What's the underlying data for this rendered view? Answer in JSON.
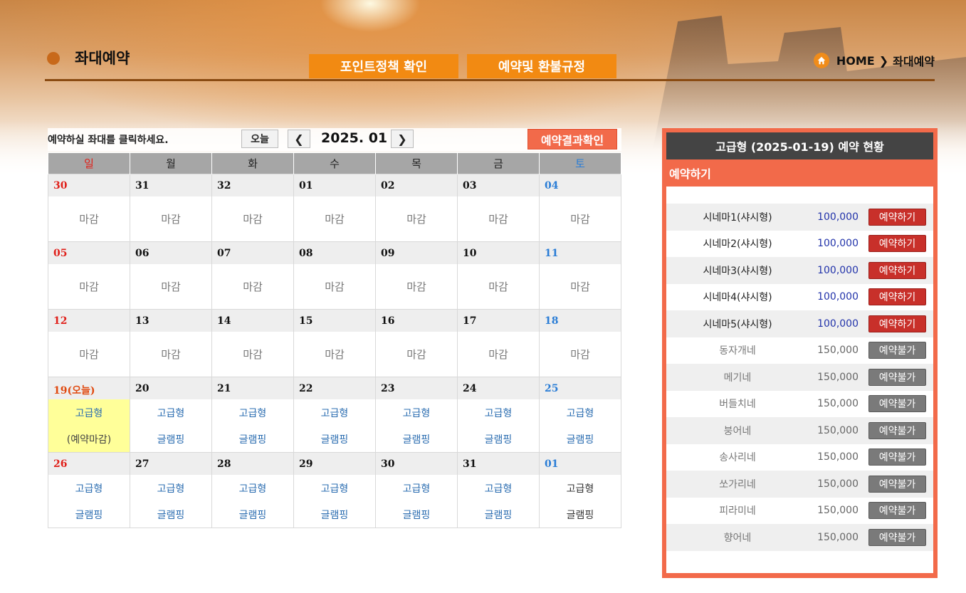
{
  "header": {
    "title": "좌대예약",
    "point_button": "포인트정책 확인",
    "refund_button": "예약및 환불규정",
    "breadcrumb_home": "HOME",
    "breadcrumb_sep": "❯",
    "breadcrumb_current": "좌대예약"
  },
  "toolbar": {
    "instruction": "예약하실 좌대를 클릭하세요.",
    "today_label": "오늘",
    "prev_label": "❮",
    "next_label": "❯",
    "month": "2025. 01",
    "result_button": "예약결과확인"
  },
  "calendar": {
    "weekdays": [
      "일",
      "월",
      "화",
      "수",
      "목",
      "금",
      "토"
    ],
    "weeks": [
      [
        "30",
        "31",
        "32",
        "01",
        "02",
        "03",
        "04"
      ],
      [
        "05",
        "06",
        "07",
        "08",
        "09",
        "10",
        "11"
      ],
      [
        "12",
        "13",
        "14",
        "15",
        "16",
        "17",
        "18"
      ],
      [
        "19(오늘)",
        "20",
        "21",
        "22",
        "23",
        "24",
        "25"
      ],
      [
        "26",
        "27",
        "28",
        "29",
        "30",
        "31",
        "01"
      ]
    ],
    "closed_label": "마감",
    "option_premium": "고급형",
    "option_glamping": "글램핑",
    "option_closed": "(예약마감)"
  },
  "panel": {
    "title": "고급형 (2025-01-19) 예약 현황",
    "subtitle": "예약하기",
    "rows": [
      {
        "name": "시네마1(샤시형)",
        "price": "100,000",
        "button": "예약하기",
        "available": true
      },
      {
        "name": "시네마2(샤시형)",
        "price": "100,000",
        "button": "예약하기",
        "available": true
      },
      {
        "name": "시네마3(샤시형)",
        "price": "100,000",
        "button": "예약하기",
        "available": true
      },
      {
        "name": "시네마4(샤시형)",
        "price": "100,000",
        "button": "예약하기",
        "available": true
      },
      {
        "name": "시네마5(샤시형)",
        "price": "100,000",
        "button": "예약하기",
        "available": true
      },
      {
        "name": "동자개네",
        "price": "150,000",
        "button": "예약불가",
        "available": false
      },
      {
        "name": "메기네",
        "price": "150,000",
        "button": "예약불가",
        "available": false
      },
      {
        "name": "버들치네",
        "price": "150,000",
        "button": "예약불가",
        "available": false
      },
      {
        "name": "붕어네",
        "price": "150,000",
        "button": "예약불가",
        "available": false
      },
      {
        "name": "송사리네",
        "price": "150,000",
        "button": "예약불가",
        "available": false
      },
      {
        "name": "쏘가리네",
        "price": "150,000",
        "button": "예약불가",
        "available": false
      },
      {
        "name": "피라미네",
        "price": "150,000",
        "button": "예약불가",
        "available": false
      },
      {
        "name": "향어네",
        "price": "150,000",
        "button": "예약불가",
        "available": false
      }
    ]
  },
  "colors": {
    "accent_orange": "#f28a12",
    "panel_red": "#f26a4a",
    "available_button": "#c8302a",
    "unavailable_button": "#7a7a7a",
    "today_highlight": "#ffff99"
  },
  "icons": {
    "home": "home-icon",
    "title_bullet": "bullet-dot-icon"
  }
}
